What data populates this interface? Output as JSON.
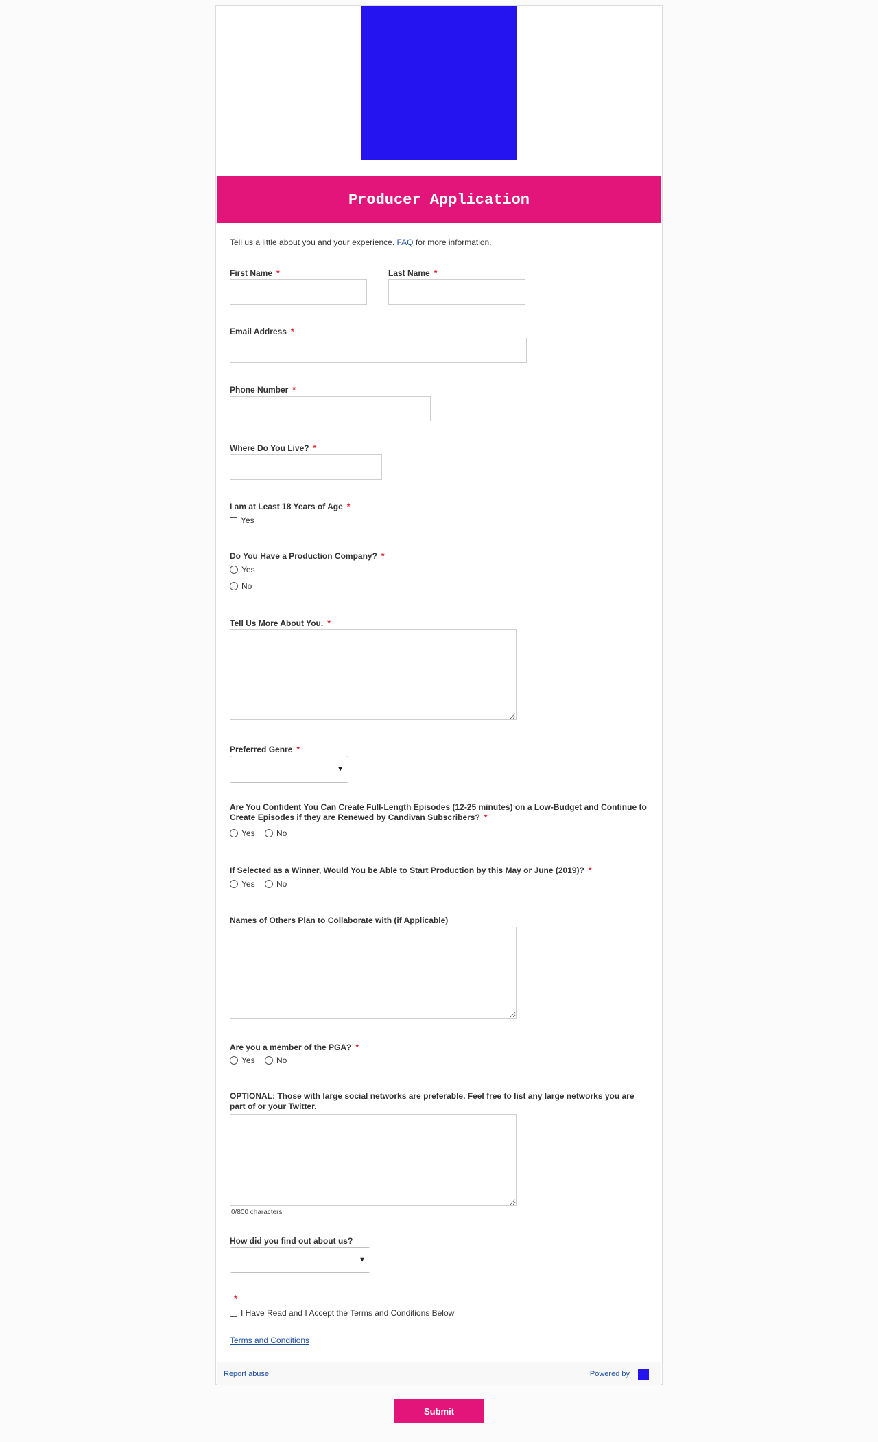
{
  "form": {
    "title": "Producer Application",
    "intro_prefix": "Tell us a little about you and your experience.",
    "faq_link": "FAQ",
    "intro_suffix": "for more information."
  },
  "fields": {
    "first_name": "First Name",
    "last_name": "Last Name",
    "email": "Email Address",
    "phone": "Phone Number",
    "location": "Where Do You Live?",
    "age": "I am at Least 18 Years of Age",
    "age_yes": "Yes",
    "company": "Do You Have a Production Company?",
    "company_yes": "Yes",
    "company_no": "No",
    "about": "Tell Us More About You.",
    "genre": "Preferred Genre",
    "confident": "Are You Confident You Can Create Full-Length Episodes (12-25 minutes) on a Low-Budget and Continue to Create Episodes if they are Renewed by Candivan Subscribers?",
    "confident_yes": "Yes",
    "confident_no": "No",
    "winner": "If Selected as a Winner, Would You be Able to Start Production by this May or June (2019)?",
    "winner_yes": "Yes",
    "winner_no": "No",
    "collaborators": "Names of Others Plan to Collaborate with (if Applicable)",
    "pga": "Are you a member of the PGA?",
    "pga_yes": "Yes",
    "pga_no": "No",
    "social": "OPTIONAL: Those with large social networks are preferable. Feel free to list any large networks you are part of or your Twitter.",
    "social_counter": "0/800 characters",
    "referral": "How did you find out about us?",
    "accept": "I Have Read and I Accept the Terms and Conditions Below",
    "terms_link": "Terms and Conditions",
    "required_mark": "*"
  },
  "footer": {
    "report": "Report abuse",
    "powered": "Powered by"
  },
  "actions": {
    "submit": "Submit"
  },
  "colors": {
    "accent": "#e4157a",
    "hero": "#2614f0",
    "link": "#1f4fa0"
  }
}
